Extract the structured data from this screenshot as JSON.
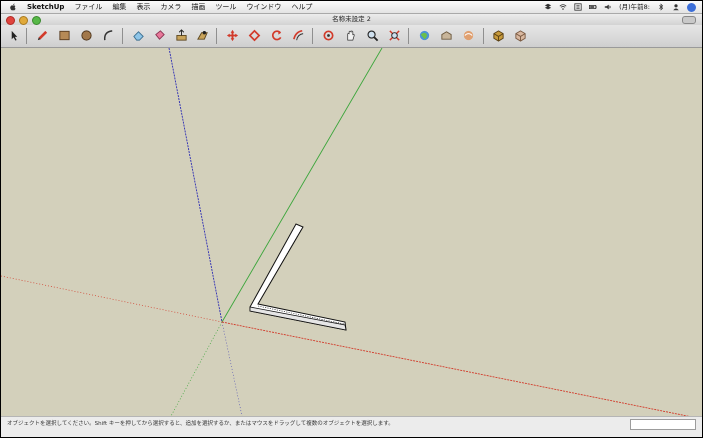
{
  "menubar": {
    "app_name": "SketchUp",
    "items": [
      "ファイル",
      "編集",
      "表示",
      "カメラ",
      "描画",
      "ツール",
      "ウインドウ",
      "ヘルプ"
    ],
    "status_icons": [
      "dropbox-icon",
      "wifi-icon",
      "input-menu-icon",
      "battery-icon",
      "volume-icon"
    ],
    "clock": "(月)午前8:",
    "status_right_icons": [
      "bluetooth-icon",
      "user-icon",
      "spotlight-icon"
    ]
  },
  "window": {
    "title": "名称未設定 2"
  },
  "toolbar": {
    "tools": [
      "select-tool",
      "pencil-tool",
      "rectangle-tool",
      "circle-tool",
      "arc-tool",
      "eraser-tool",
      "paint-bucket-tool",
      "push-pull-tool",
      "follow-me-tool",
      "move-tool",
      "rotate-tool",
      "scale-tool",
      "offset-tool",
      "orbit-tool",
      "pan-tool",
      "zoom-tool",
      "zoom-extents-tool",
      "get-models-tool",
      "share-model-tool",
      "upload-tool",
      "component-tool",
      "3d-warehouse-tool"
    ]
  },
  "statusbar": {
    "hint": "オブジェクトを選択してください。Shift キーを押してから選択すると、追加を選択するか、またはマウスをドラッグして複数のオブジェクトを選択します。",
    "measurements_value": ""
  },
  "colors": {
    "canvas": "#d3d0bb",
    "axis_red": "#d23a2a",
    "axis_green": "#3aa53a",
    "axis_blue": "#2c2cb4"
  }
}
